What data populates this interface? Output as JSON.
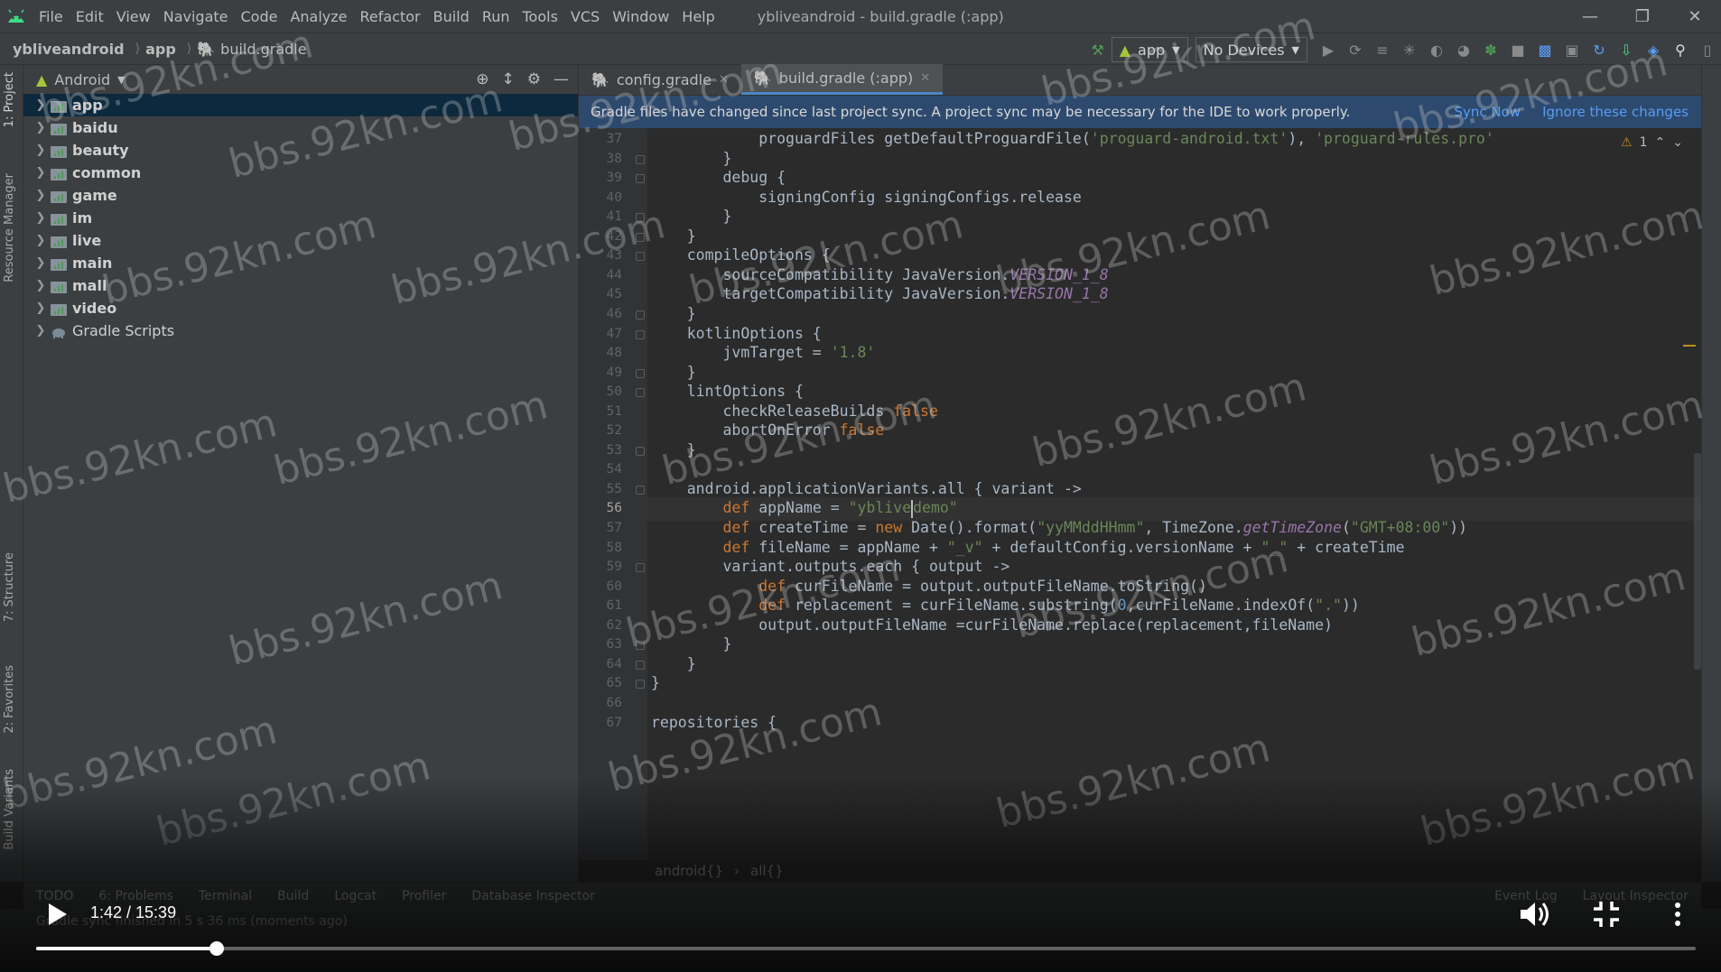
{
  "menubar": {
    "items": [
      "File",
      "Edit",
      "View",
      "Navigate",
      "Code",
      "Analyze",
      "Refactor",
      "Build",
      "Run",
      "Tools",
      "VCS",
      "Window",
      "Help"
    ],
    "mnemonics": [
      "F",
      "E",
      "V",
      "N",
      "C",
      "z",
      "R",
      "B",
      "u",
      "T",
      "S",
      "W",
      "H"
    ],
    "window_title": "ybliveandroid - build.gradle (:app)"
  },
  "navbar": {
    "crumbs": [
      "ybliveandroid",
      "app",
      "build.gradle"
    ],
    "run_config": "app",
    "device": "No Devices"
  },
  "left_stripe": {
    "tabs": [
      "1: Project",
      "Resource Manager",
      "7: Structure",
      "2: Favorites",
      "Build Variants"
    ]
  },
  "project_panel": {
    "view_mode": "Android",
    "tree": [
      {
        "label": "app",
        "bold": true,
        "selected": true,
        "type": "module"
      },
      {
        "label": "baidu",
        "bold": true,
        "type": "module"
      },
      {
        "label": "beauty",
        "bold": true,
        "type": "module"
      },
      {
        "label": "common",
        "bold": true,
        "type": "module"
      },
      {
        "label": "game",
        "bold": true,
        "type": "module"
      },
      {
        "label": "im",
        "bold": true,
        "type": "module"
      },
      {
        "label": "live",
        "bold": true,
        "type": "module"
      },
      {
        "label": "main",
        "bold": true,
        "type": "module"
      },
      {
        "label": "mall",
        "bold": true,
        "type": "module"
      },
      {
        "label": "video",
        "bold": true,
        "type": "module"
      },
      {
        "label": "Gradle Scripts",
        "bold": false,
        "type": "gradle"
      }
    ]
  },
  "editor": {
    "tabs": [
      {
        "label": "config.gradle",
        "active": false
      },
      {
        "label": "build.gradle (:app)",
        "active": true
      }
    ],
    "banner": {
      "message": "Gradle files have changed since last project sync. A project sync may be necessary for the IDE to work properly.",
      "sync_now": "Sync Now",
      "ignore": "Ignore these changes"
    },
    "warning_count": "1",
    "current_line": 56,
    "lines": [
      {
        "n": "37",
        "t": [
          [
            "p",
            "            proguardFiles getDefaultProguardFile("
          ],
          [
            "s",
            "'proguard-android.txt'"
          ],
          [
            "p",
            "), "
          ],
          [
            "s",
            "'proguard-rules.pro'"
          ]
        ]
      },
      {
        "n": "38",
        "t": [
          [
            "p",
            "        }"
          ]
        ]
      },
      {
        "n": "39",
        "t": [
          [
            "p",
            "        debug {"
          ]
        ]
      },
      {
        "n": "40",
        "t": [
          [
            "p",
            "            signingConfig signingConfigs.release"
          ]
        ]
      },
      {
        "n": "41",
        "t": [
          [
            "p",
            "        }"
          ]
        ]
      },
      {
        "n": "42",
        "t": [
          [
            "p",
            "    }"
          ]
        ]
      },
      {
        "n": "43",
        "t": [
          [
            "p",
            "    compileOptions {"
          ]
        ]
      },
      {
        "n": "44",
        "t": [
          [
            "p",
            "        sourceCompatibility JavaVersion."
          ],
          [
            "i",
            "VERSION_1_8"
          ]
        ]
      },
      {
        "n": "45",
        "t": [
          [
            "p",
            "        targetCompatibility JavaVersion."
          ],
          [
            "i",
            "VERSION_1_8"
          ]
        ]
      },
      {
        "n": "46",
        "t": [
          [
            "p",
            "    }"
          ]
        ]
      },
      {
        "n": "47",
        "t": [
          [
            "p",
            "    kotlinOptions {"
          ]
        ]
      },
      {
        "n": "48",
        "t": [
          [
            "p",
            "        jvmTarget = "
          ],
          [
            "s",
            "'1.8'"
          ]
        ]
      },
      {
        "n": "49",
        "t": [
          [
            "p",
            "    }"
          ]
        ]
      },
      {
        "n": "50",
        "t": [
          [
            "p",
            "    lintOptions {"
          ]
        ]
      },
      {
        "n": "51",
        "t": [
          [
            "p",
            "        checkReleaseBuilds "
          ],
          [
            "k",
            "false"
          ]
        ]
      },
      {
        "n": "52",
        "t": [
          [
            "p",
            "        abortOnError "
          ],
          [
            "k",
            "false"
          ]
        ]
      },
      {
        "n": "53",
        "t": [
          [
            "p",
            "    }"
          ]
        ]
      },
      {
        "n": "54",
        "t": [
          [
            "p",
            ""
          ]
        ]
      },
      {
        "n": "55",
        "t": [
          [
            "p",
            "    android.applicationVariants.all { variant ->"
          ]
        ]
      },
      {
        "n": "56",
        "t": [
          [
            "k",
            "        def "
          ],
          [
            "p",
            "appName = "
          ],
          [
            "s",
            "\"yblive"
          ],
          [
            "c",
            ""
          ],
          [
            "s",
            "demo\""
          ]
        ]
      },
      {
        "n": "57",
        "t": [
          [
            "k",
            "        def "
          ],
          [
            "p",
            "createTime = "
          ],
          [
            "k",
            "new "
          ],
          [
            "p",
            "Date().format("
          ],
          [
            "s",
            "\"yyMMddHHmm\""
          ],
          [
            "p",
            ", TimeZone."
          ],
          [
            "i",
            "getTimeZone"
          ],
          [
            "p",
            "("
          ],
          [
            "s",
            "\"GMT+08:00\""
          ],
          [
            "p",
            "))"
          ]
        ]
      },
      {
        "n": "58",
        "t": [
          [
            "k",
            "        def "
          ],
          [
            "p",
            "fileName = appName + "
          ],
          [
            "s",
            "\"_v\""
          ],
          [
            "p",
            " + defaultConfig.versionName + "
          ],
          [
            "s",
            "\"_\""
          ],
          [
            "p",
            " + createTime"
          ]
        ]
      },
      {
        "n": "59",
        "t": [
          [
            "p",
            "        variant.outputs.each { output ->"
          ]
        ]
      },
      {
        "n": "60",
        "t": [
          [
            "k",
            "            def "
          ],
          [
            "p",
            "curFileName = output.outputFileName.toString()"
          ]
        ]
      },
      {
        "n": "61",
        "t": [
          [
            "k",
            "            def "
          ],
          [
            "p",
            "replacement = curFileName.substring("
          ],
          [
            "n",
            "0"
          ],
          [
            "p",
            ",curFileName.indexOf("
          ],
          [
            "s",
            "\".\""
          ],
          [
            "p",
            "))"
          ]
        ]
      },
      {
        "n": "62",
        "t": [
          [
            "p",
            "            output.outputFileName =curFileName.replace(replacement,fileName)"
          ]
        ]
      },
      {
        "n": "63",
        "t": [
          [
            "p",
            "        }"
          ]
        ]
      },
      {
        "n": "64",
        "t": [
          [
            "p",
            "    }"
          ]
        ]
      },
      {
        "n": "65",
        "t": [
          [
            "p",
            "}"
          ]
        ]
      },
      {
        "n": "66",
        "t": [
          [
            "p",
            ""
          ]
        ]
      },
      {
        "n": "67",
        "t": [
          [
            "p",
            "repositories {"
          ]
        ]
      }
    ],
    "breadcrumb": [
      "android{}",
      "all{}"
    ]
  },
  "bottom_tools": {
    "left": [
      "TODO",
      "6: Problems",
      "Terminal",
      "Build",
      "Logcat",
      "Profiler",
      "Database Inspector"
    ],
    "right": [
      "Event Log",
      "Layout Inspector"
    ]
  },
  "status_bar": {
    "message": "Gradle sync finished in 5 s 36 ms (moments ago)"
  },
  "video": {
    "time": "1:42 / 15:39",
    "progress": 0.1086
  },
  "watermark": "bbs.92kn.com",
  "colors": {
    "accent_blue": "#589df6",
    "banner_bg": "#2d4a6e",
    "keyword": "#cc7832",
    "string": "#6a8759",
    "constant": "#9876aa",
    "android_green": "#a4c639"
  }
}
